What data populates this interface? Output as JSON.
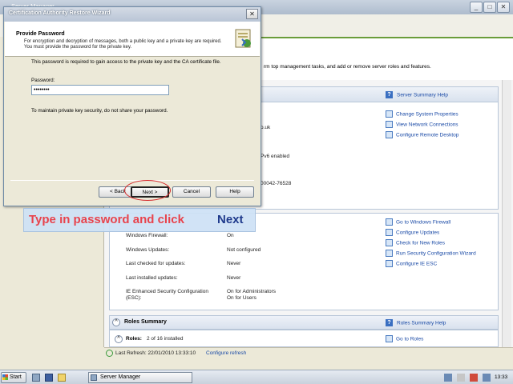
{
  "server_manager": {
    "window_title": "Server Manager",
    "banner_text": "rm top management tasks, and add or remove server roles and features.",
    "computer_info": {
      "help_link": "Server Summary Help",
      "partial_values": [
        "o.uk",
        "Pv6 enabled",
        "00042-76528"
      ],
      "links": [
        "Change System Properties",
        "View Network Connections",
        "Configure Remote Desktop"
      ]
    },
    "security_info": {
      "rows": [
        {
          "label": "Windows Firewall:",
          "value": "On"
        },
        {
          "label": "Windows Updates:",
          "value": "Not configured"
        },
        {
          "label": "Last checked for updates:",
          "value": "Never"
        },
        {
          "label": "Last installed updates:",
          "value": "Never"
        },
        {
          "label": "IE Enhanced Security Configuration (ESC):",
          "value": "On for Administrators\nOn for Users"
        }
      ],
      "links": [
        "Go to Windows Firewall",
        "Configure Updates",
        "Check for New Roles",
        "Run Security Configuration Wizard",
        "Configure IE ESC"
      ]
    },
    "roles_summary": {
      "title": "Roles Summary",
      "help_link": "Roles Summary Help",
      "roles_label": "Roles:",
      "roles_count": "2 of 16 installed",
      "go_to_roles": "Go to Roles"
    },
    "status_bar": {
      "last_refresh": "Last Refresh: 22/01/2010 13:33:10",
      "configure_refresh": "Configure refresh"
    }
  },
  "wizard": {
    "title": "Certification Authority Restore Wizard",
    "heading": "Provide Password",
    "subheading": "For encryption and decryption of messages, both a public key and a private key are required. You must provide the password for the private key.",
    "body_text": "This password is required to gain access to the private key and the CA certificate file.",
    "password_label": "Password:",
    "password_value": "••••••••",
    "warning_text": "To maintain private key security, do not share your password.",
    "buttons": {
      "back": "< Back",
      "next": "Next >",
      "cancel": "Cancel",
      "help": "Help"
    }
  },
  "annotation": {
    "text_part1": "Type in password and click",
    "text_part2": "Next",
    "text_color": "#e8434c",
    "highlight_color": "#1f3a8c"
  },
  "taskbar": {
    "start_label": "Start",
    "task_label": "Server Manager",
    "clock": "13:33"
  }
}
